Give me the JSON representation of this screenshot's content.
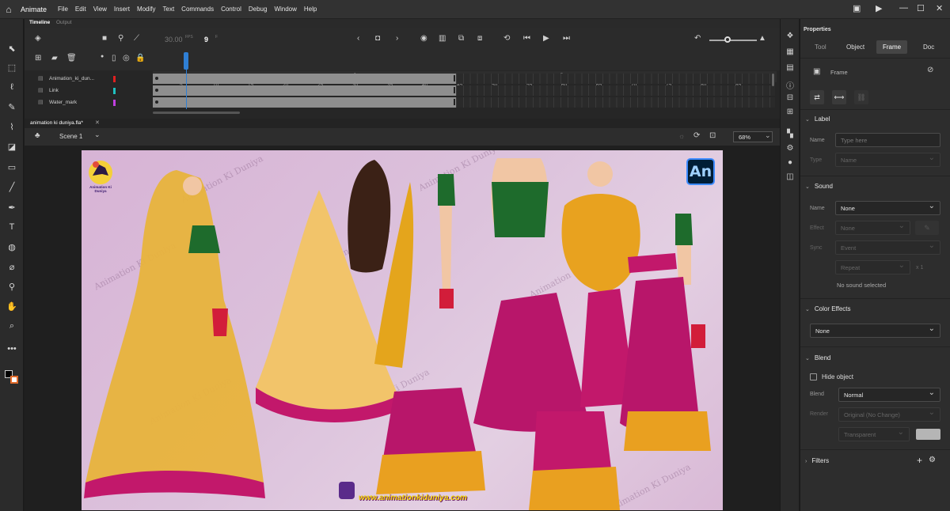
{
  "menubar": {
    "app_name": "Animate",
    "items": [
      "File",
      "Edit",
      "View",
      "Insert",
      "Modify",
      "Text",
      "Commands",
      "Control",
      "Debug",
      "Window",
      "Help"
    ]
  },
  "timeline": {
    "tabs": [
      "Timeline",
      "Output"
    ],
    "fps": "30.00",
    "fps_unit": "FPS",
    "current_frame": "9",
    "frame_unit": "F",
    "ruler_numbers": [
      "5",
      "10",
      "15",
      "20",
      "25",
      "30",
      "35",
      "40",
      "45",
      "50",
      "55",
      "60",
      "65",
      "70",
      "75",
      "80",
      "85"
    ],
    "ruler_seconds": [
      "1s",
      "2s"
    ],
    "layers": [
      {
        "name": "Animation_ki_dun...",
        "color": "#e02020"
      },
      {
        "name": "Link",
        "color": "#20c0c0"
      },
      {
        "name": "Water_mark",
        "color": "#c040e0"
      }
    ]
  },
  "document": {
    "tab_name": "animation ki duniya.fla*",
    "scene": "Scene 1",
    "zoom": "68%",
    "watermark_text": "Animation Ki Duniya",
    "site_url": "www.animationkiduniya.com",
    "an_logo": "An",
    "logo_caption": "Animation Ki Duniya"
  },
  "properties": {
    "title": "Properties",
    "tabs": [
      "Tool",
      "Object",
      "Frame",
      "Doc"
    ],
    "active_tab": "Frame",
    "frame_label": "Frame",
    "label_section": "Label",
    "name_label": "Name",
    "name_placeholder": "Type here",
    "type_label": "Type",
    "type_value": "Name",
    "sound_section": "Sound",
    "sound_name_label": "Name",
    "sound_name_value": "None",
    "effect_label": "Effect",
    "effect_value": "None",
    "sync_label": "Sync",
    "sync_value": "Event",
    "repeat_value": "Repeat",
    "repeat_count": "x 1",
    "no_sound": "No sound selected",
    "color_effects_section": "Color Effects",
    "color_effects_value": "None",
    "blend_section": "Blend",
    "hide_object": "Hide object",
    "blend_label": "Blend",
    "blend_value": "Normal",
    "render_label": "Render",
    "render_value": "Original (No Change)",
    "transparent_value": "Transparent",
    "filters_section": "Filters"
  }
}
